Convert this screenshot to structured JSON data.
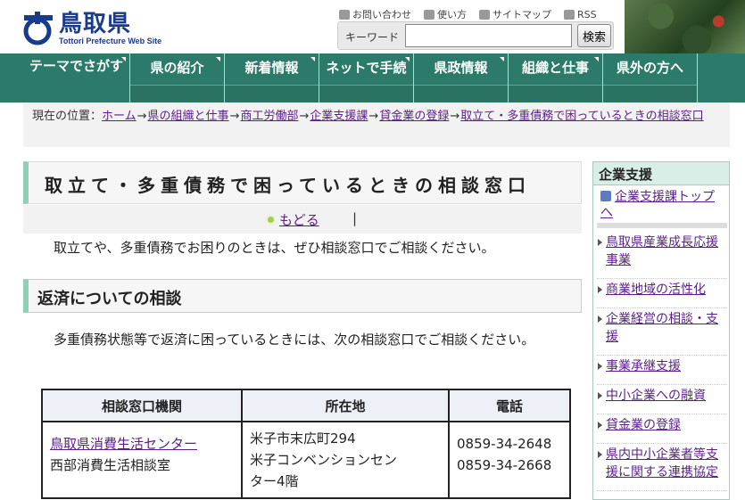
{
  "header": {
    "site_name": "鳥取県",
    "site_name_en": "Tottori Prefecture Web Site",
    "util_links": [
      {
        "label": "お問い合わせ",
        "icon": "contact-icon"
      },
      {
        "label": "使い方",
        "icon": "help-icon"
      },
      {
        "label": "サイトマップ",
        "icon": "sitemap-icon"
      },
      {
        "label": "RSS",
        "icon": "rss-icon"
      }
    ],
    "search": {
      "label": "キーワード",
      "value": "",
      "button": "検索"
    }
  },
  "nav": {
    "items": [
      {
        "label": "テーマでさがす"
      },
      {
        "label": "県の紹介"
      },
      {
        "label": "新着情報"
      },
      {
        "label": "ネットで手続"
      },
      {
        "label": "県政情報"
      },
      {
        "label": "組織と仕事"
      },
      {
        "label": "県外の方へ"
      }
    ]
  },
  "breadcrumb": {
    "prefix": "現在の位置：",
    "items": [
      "ホーム",
      "県の組織と仕事",
      "商工労働部",
      "企業支援課",
      "貸金業の登録",
      "取立て・多重債務で困っているときの相談窓口"
    ],
    "separator": "→"
  },
  "main": {
    "title": "取立て・多重債務で困っているときの相談窓口",
    "back_label": "もどる",
    "back_sep": "|",
    "lead": "取立てや、多重債務でお困りのときは、ぜひ相談窓口でご相談ください。",
    "section_title": "返済についての相談",
    "section_text": "多重債務状態等で返済に困っているときには、次の相談窓口でご相談ください。",
    "table": {
      "headers": [
        "相談窓口機関",
        "所在地",
        "電話"
      ],
      "rows": [
        {
          "org_link": "鳥取県消費生活センター",
          "org_sub": "西部消費生活相談室",
          "address_1": "米子市末広町294",
          "address_2": "米子コンベンションセン",
          "address_3": "ター4階",
          "tel_1": "0859-34-2648",
          "tel_2": "0859-34-2668"
        }
      ]
    }
  },
  "sidebar": {
    "heading": "企業支援",
    "top_link": "企業支援課トップへ",
    "items": [
      {
        "label": "鳥取県産業成長応援事業"
      },
      {
        "label": "商業地域の活性化"
      },
      {
        "label": "企業経営の相談・支援"
      },
      {
        "label": "事業承継支援"
      },
      {
        "label": "中小企業への融資"
      },
      {
        "label": "貸金業の登録"
      },
      {
        "label": "県内中小企業者等支援に関する連携協定"
      }
    ]
  },
  "colors": {
    "nav_bg": "#2c7a6a",
    "link": "#5a1f8a",
    "heading_accent": "#8fd0b6",
    "logo": "#1a3a8a"
  }
}
